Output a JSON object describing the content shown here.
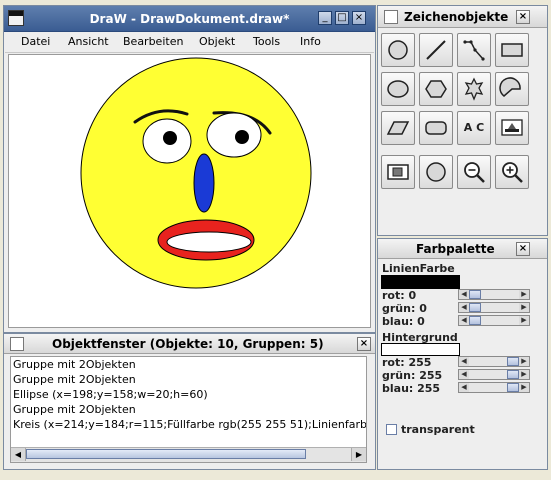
{
  "draw_window": {
    "title": "DraW - DrawDokument.draw*",
    "menu": [
      "Datei",
      "Ansicht",
      "Bearbeiten",
      "Objekt",
      "Tools",
      "Info"
    ]
  },
  "tools_window": {
    "title": "Zeichenobjekte",
    "tools": [
      "circle-tool",
      "line-tool",
      "polyline-tool",
      "rectangle-tool",
      "ellipse-tool",
      "hexagon-tool",
      "star-tool",
      "arc-tool",
      "parallelogram-tool",
      "rounded-rect-tool",
      "text-tool",
      "image-tool",
      "resize-tool",
      "circle-outline-tool",
      "zoom-out-tool",
      "zoom-in-tool"
    ],
    "text_tool_glyph": "A C"
  },
  "palette_window": {
    "title": "Farbpalette",
    "line_color_label": "LinienFarbe",
    "line_color": "#000000",
    "line_rgb": {
      "rot": "rot: 0",
      "gruen": "grün: 0",
      "blau": "blau: 0"
    },
    "line_levels": [
      0,
      0,
      0
    ],
    "background_label": "Hintergrund",
    "background_color": "#ffffff",
    "bg_rgb": {
      "rot": "rot: 255",
      "gruen": "grün: 255",
      "blau": "blau: 255"
    },
    "bg_levels": [
      255,
      255,
      255
    ],
    "transparent_label": "transparent",
    "transparent_checked": false
  },
  "object_window": {
    "title": "Objektfenster (Objekte: 10, Gruppen: 5)",
    "items": [
      "Gruppe mit 2Objekten",
      "Gruppe mit 2Objekten",
      "Ellipse (x=198;y=158;w=20;h=60)",
      "Gruppe mit 2Objekten",
      "Kreis (x=214;y=184;r=115;Füllfarbe rgb(255 255 51);Linienfarbe"
    ]
  },
  "colors": {
    "face": "#ffff33",
    "nose": "#1a3ad6",
    "mouth": "#e8231e",
    "eye_white": "#ffffff",
    "pupil": "#000000"
  },
  "close_glyph": "×"
}
